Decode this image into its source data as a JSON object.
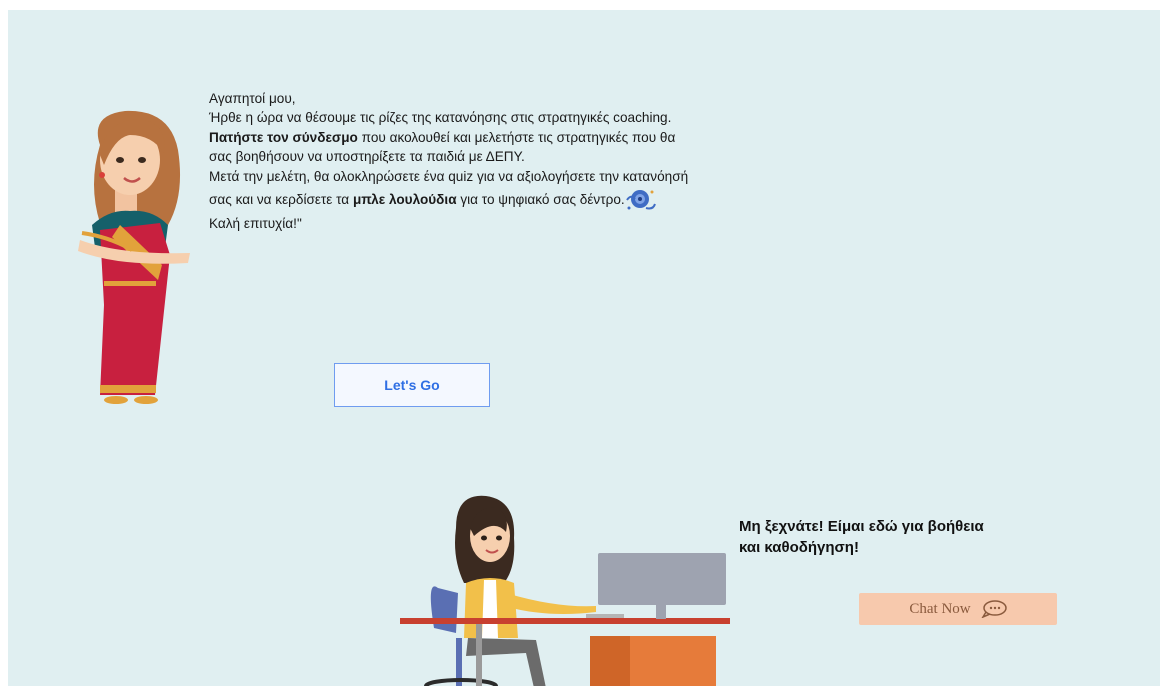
{
  "message": {
    "greeting": "Αγαπητοί μου,",
    "line1_start": "Ήρθε η ώρα να θέσουμε τις ρίζες της κατανόησης στις στρατηγικές coaching. ",
    "link_bold": "Πατήστε τον σύνδεσμο",
    "line1_end": " που ακολουθεί και μελετήστε τις στρατηγικές που θα σας βοηθήσουν να υποστηρίξετε τα παιδιά με ΔΕΠΥ.",
    "line2_start": "Μετά την μελέτη, θα ολοκληρώσετε ένα quiz για να αξιολογήσετε την κατανόησή σας και να κερδίσετε τα ",
    "flowers_bold": "μπλε λουλούδια",
    "line2_end": " για το ψηφιακό σας δέντρο.",
    "closing": "Καλή επιτυχία!\""
  },
  "lets_go_label": "Let's Go",
  "reminder": {
    "line1": "Μη ξεχνάτε! Είμαι εδώ για βοήθεια",
    "line2": "και καθοδήγηση!"
  },
  "chat": {
    "label": "Chat Now",
    "icon": "chat-bubble-icon"
  },
  "colors": {
    "background": "#e0eff1",
    "lets_go_text": "#2f6fe4",
    "chat_button": "#f7c9ad"
  }
}
